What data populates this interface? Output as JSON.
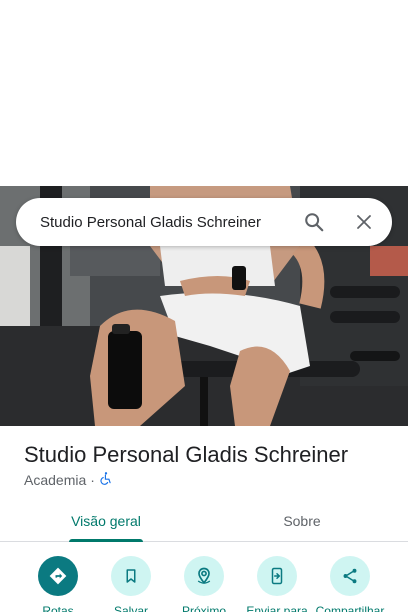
{
  "search": {
    "query": "Studio Personal Gladis Schreiner"
  },
  "place": {
    "title": "Studio Personal Gladis Schreiner",
    "category": "Academia",
    "separator": "·"
  },
  "tabs": [
    {
      "label": "Visão geral",
      "active": true
    },
    {
      "label": "Sobre",
      "active": false
    }
  ],
  "actions": [
    {
      "label": "Rotas",
      "icon": "directions-icon"
    },
    {
      "label": "Salvar",
      "icon": "bookmark-icon"
    },
    {
      "label": "Próximo",
      "icon": "nearby-icon"
    },
    {
      "label": "Enviar para",
      "icon": "send-to-phone-icon"
    },
    {
      "label": "Compartilhar",
      "icon": "share-icon"
    }
  ],
  "colors": {
    "accent": "#00796b",
    "primary_button": "#0b7a81",
    "secondary_button": "#cff5f2"
  }
}
